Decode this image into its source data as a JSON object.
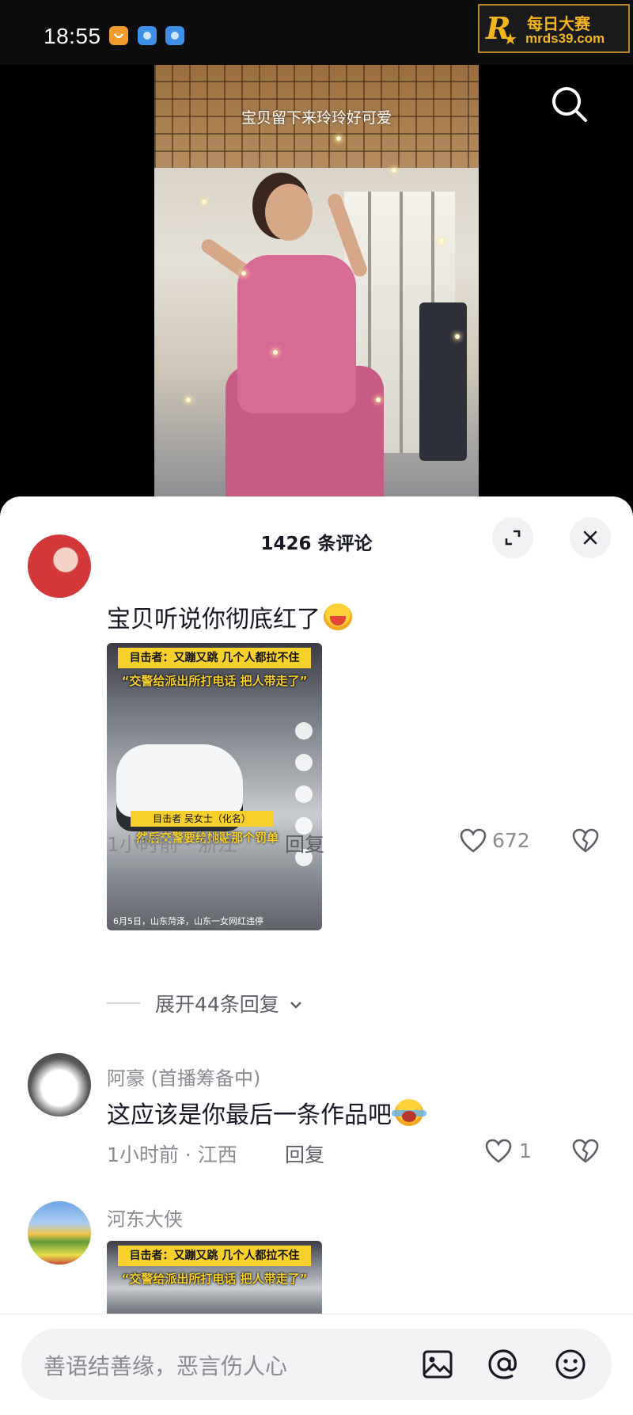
{
  "status_bar": {
    "time": "18:55",
    "watermark_cn": "每日大赛",
    "watermark_url": "mrds39.com"
  },
  "video": {
    "caption": "宝贝留下来玲玲好可爱"
  },
  "comments_sheet": {
    "title": "1426 条评论",
    "comments": [
      {
        "name": "",
        "text": "宝贝听说你彻底红了",
        "emoji": "laughing-face-emoji",
        "image": {
          "headline": "目击者：又蹦又跳 几个人都拉不住",
          "subheadline": "“交警给派出所打电话 把人带走了”",
          "caption_tag": "目击者 吴女士（化名）",
          "caption": "然后交警要给她贴那个罚单",
          "footer": "6月5日，山东菏泽，山东一女网红违停"
        },
        "time_location": "1小时前 · 浙江",
        "reply_label": "回复",
        "likes": "672",
        "expand_replies": "展开44条回复"
      },
      {
        "name": "阿豪 (首播筹备中)",
        "text": "这应该是你最后一条作品吧",
        "emoji": "crying-face-emoji",
        "time_location": "1小时前 · 江西",
        "reply_label": "回复",
        "likes": "1"
      },
      {
        "name": "河东大侠",
        "image": {
          "headline": "目击者：又蹦又跳 几个人都拉不住",
          "subheadline": "“交警给派出所打电话 把人带走了”"
        }
      }
    ]
  },
  "input_bar": {
    "placeholder": "善语结善缘，恶言伤人心",
    "icons": [
      "image-icon",
      "mention-at-icon",
      "emoji-icon"
    ]
  },
  "colors": {
    "text_primary": "#161823",
    "text_secondary": "#8a8b91",
    "accent_status_orange": "#f39a2c",
    "accent_status_blue": "#3f8fe9"
  }
}
